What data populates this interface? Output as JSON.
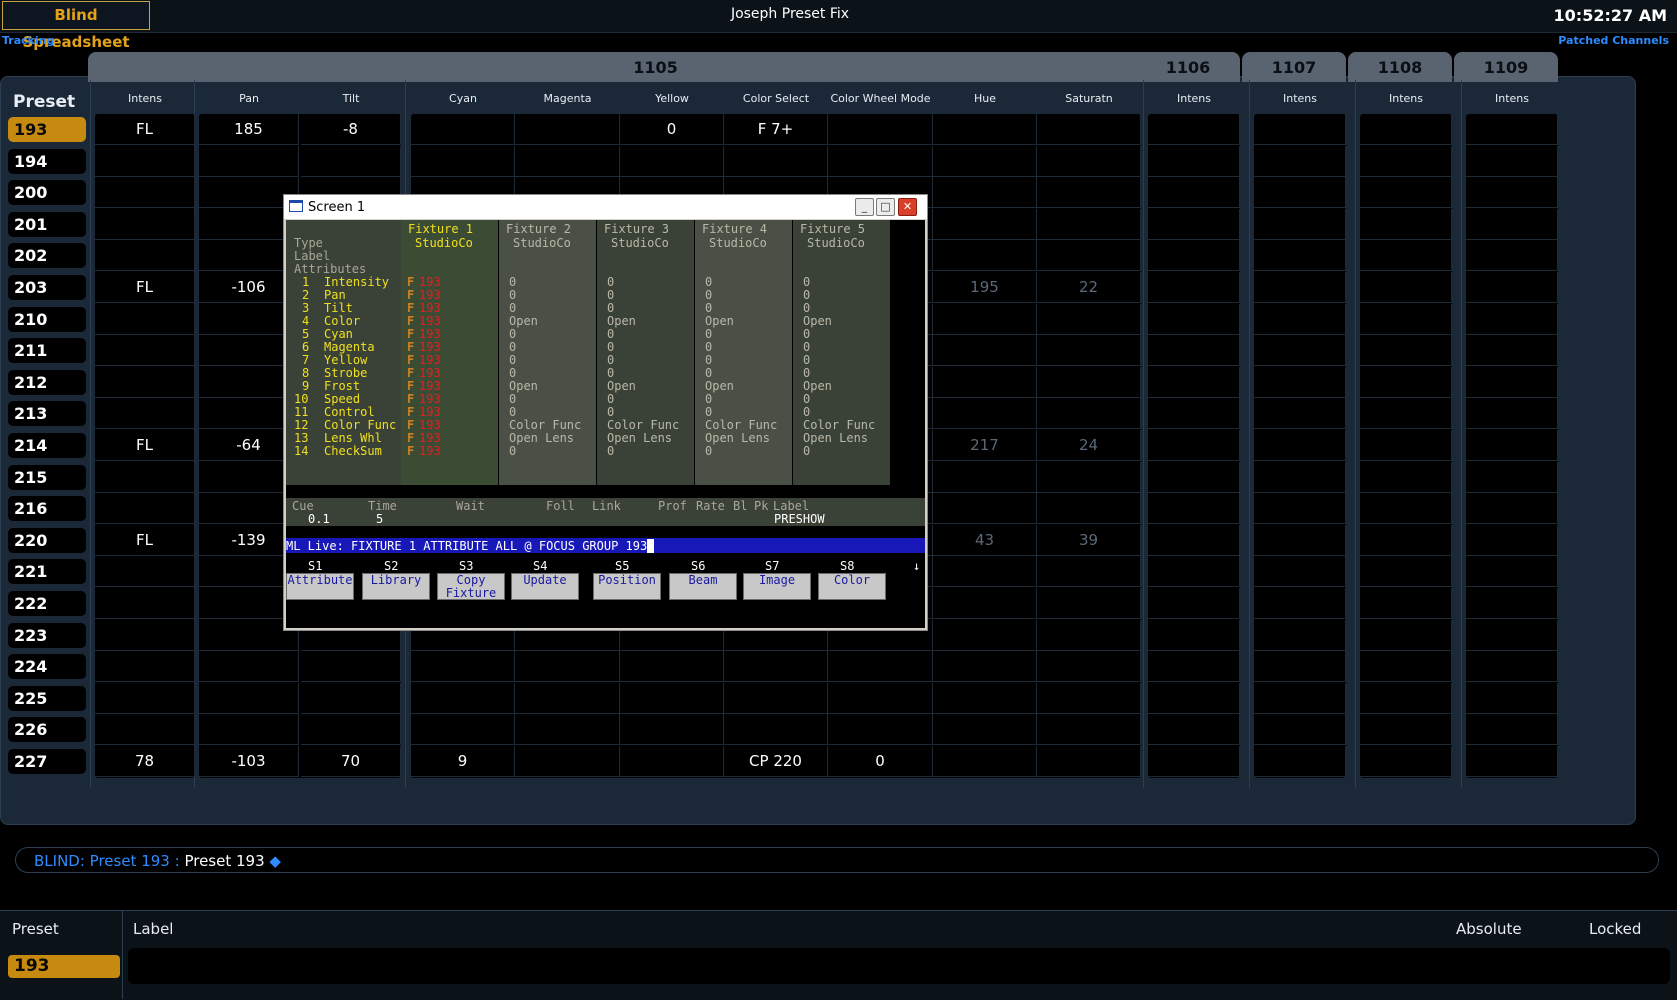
{
  "header": {
    "app_title": "Blind Spreadsheet",
    "show_name": "Joseph Preset Fix",
    "clock": "10:52:27 AM",
    "mode_left": "Tracking",
    "mode_right": "Patched Channels"
  },
  "sheet": {
    "preset_header": "Preset",
    "channel_groups": [
      "1105",
      "1106",
      "1107",
      "1108",
      "1109"
    ],
    "columns": [
      "Intens",
      "Pan",
      "Tilt",
      "Cyan",
      "Magenta",
      "Yellow",
      "Color Select",
      "Color Wheel Mode",
      "Hue",
      "Saturatn",
      "Intens",
      "Intens",
      "Intens",
      "Intens"
    ],
    "rows": [
      {
        "preset": "193",
        "cells": [
          "FL",
          "185",
          "-8",
          "",
          "",
          "0",
          "F 7+",
          "",
          "",
          "",
          "",
          "",
          "",
          ""
        ]
      },
      {
        "preset": "194",
        "cells": [
          "",
          "",
          "",
          "",
          "",
          "",
          "",
          "",
          "",
          "",
          "",
          "",
          "",
          ""
        ]
      },
      {
        "preset": "200",
        "cells": [
          "",
          "",
          "",
          "",
          "",
          "",
          "",
          "",
          "",
          "",
          "",
          "",
          "",
          ""
        ]
      },
      {
        "preset": "201",
        "cells": [
          "",
          "",
          "",
          "",
          "",
          "",
          "",
          "",
          "",
          "",
          "",
          "",
          "",
          ""
        ]
      },
      {
        "preset": "202",
        "cells": [
          "",
          "",
          "",
          "",
          "",
          "",
          "",
          "",
          "",
          "",
          "",
          "",
          "",
          ""
        ]
      },
      {
        "preset": "203",
        "cells": [
          "FL",
          "-106",
          "",
          "",
          "",
          "",
          "",
          "",
          "195",
          "22",
          "",
          "",
          "",
          ""
        ]
      },
      {
        "preset": "210",
        "cells": [
          "",
          "",
          "",
          "",
          "",
          "",
          "",
          "",
          "",
          "",
          "",
          "",
          "",
          ""
        ]
      },
      {
        "preset": "211",
        "cells": [
          "",
          "",
          "",
          "",
          "",
          "",
          "",
          "",
          "",
          "",
          "",
          "",
          "",
          ""
        ]
      },
      {
        "preset": "212",
        "cells": [
          "",
          "",
          "",
          "",
          "",
          "",
          "",
          "",
          "",
          "",
          "",
          "",
          "",
          ""
        ]
      },
      {
        "preset": "213",
        "cells": [
          "",
          "",
          "",
          "",
          "",
          "",
          "",
          "",
          "",
          "",
          "",
          "",
          "",
          ""
        ]
      },
      {
        "preset": "214",
        "cells": [
          "FL",
          "-64",
          "",
          "",
          "",
          "",
          "",
          "",
          "217",
          "24",
          "",
          "",
          "",
          ""
        ]
      },
      {
        "preset": "215",
        "cells": [
          "",
          "",
          "",
          "",
          "",
          "",
          "",
          "",
          "",
          "",
          "",
          "",
          "",
          ""
        ]
      },
      {
        "preset": "216",
        "cells": [
          "",
          "",
          "",
          "",
          "",
          "",
          "",
          "",
          "",
          "",
          "",
          "",
          "",
          ""
        ]
      },
      {
        "preset": "220",
        "cells": [
          "FL",
          "-139",
          "",
          "",
          "",
          "",
          "",
          "",
          "43",
          "39",
          "",
          "",
          "",
          ""
        ]
      },
      {
        "preset": "221",
        "cells": [
          "",
          "",
          "",
          "",
          "",
          "",
          "",
          "",
          "",
          "",
          "",
          "",
          "",
          ""
        ]
      },
      {
        "preset": "222",
        "cells": [
          "",
          "",
          "",
          "",
          "",
          "",
          "",
          "",
          "",
          "",
          "",
          "",
          "",
          ""
        ]
      },
      {
        "preset": "223",
        "cells": [
          "",
          "",
          "",
          "",
          "",
          "",
          "",
          "",
          "",
          "",
          "",
          "",
          "",
          ""
        ]
      },
      {
        "preset": "224",
        "cells": [
          "",
          "",
          "",
          "",
          "",
          "",
          "",
          "",
          "",
          "",
          "",
          "",
          "",
          ""
        ]
      },
      {
        "preset": "225",
        "cells": [
          "",
          "",
          "",
          "",
          "",
          "",
          "",
          "",
          "",
          "",
          "",
          "",
          "",
          ""
        ]
      },
      {
        "preset": "226",
        "cells": [
          "",
          "",
          "",
          "",
          "",
          "",
          "",
          "",
          "",
          "",
          "",
          "",
          "",
          ""
        ]
      },
      {
        "preset": "227",
        "cells": [
          "78",
          "-103",
          "70",
          "9",
          "",
          "",
          "CP 220",
          "0",
          "",
          "",
          "",
          "",
          "",
          ""
        ]
      }
    ]
  },
  "command_line": {
    "blind": "BLIND: Preset  193 :",
    "text": "Preset 193"
  },
  "bottom": {
    "preset_label": "Preset",
    "label_label": "Label",
    "absolute_label": "Absolute",
    "locked_label": "Locked",
    "preset_value": "193"
  },
  "screen1": {
    "title": "Screen 1",
    "row_labels": [
      "Type",
      "Label",
      "Attributes"
    ],
    "fixtures": [
      {
        "name": "Fixture 1",
        "type": "StudioCo"
      },
      {
        "name": "Fixture 2",
        "type": "StudioCo"
      },
      {
        "name": "Fixture 3",
        "type": "StudioCo"
      },
      {
        "name": "Fixture 4",
        "type": "StudioCo"
      },
      {
        "name": "Fixture 5",
        "type": "StudioCo"
      }
    ],
    "attributes": [
      {
        "num": "1",
        "name": "Intensity",
        "f1": "193",
        "other": "0"
      },
      {
        "num": "2",
        "name": "Pan",
        "f1": "193",
        "other": "0"
      },
      {
        "num": "3",
        "name": "Tilt",
        "f1": "193",
        "other": "0"
      },
      {
        "num": "4",
        "name": "Color",
        "f1": "193",
        "other": "Open"
      },
      {
        "num": "5",
        "name": "Cyan",
        "f1": "193",
        "other": "0"
      },
      {
        "num": "6",
        "name": "Magenta",
        "f1": "193",
        "other": "0"
      },
      {
        "num": "7",
        "name": "Yellow",
        "f1": "193",
        "other": "0"
      },
      {
        "num": "8",
        "name": "Strobe",
        "f1": "193",
        "other": "0"
      },
      {
        "num": "9",
        "name": "Frost",
        "f1": "193",
        "other": "Open"
      },
      {
        "num": "10",
        "name": "Speed",
        "f1": "193",
        "other": "0"
      },
      {
        "num": "11",
        "name": "Control",
        "f1": "193",
        "other": "0"
      },
      {
        "num": "12",
        "name": "Color Func",
        "f1": "193",
        "other": "Color Func"
      },
      {
        "num": "13",
        "name": "Lens Whl",
        "f1": "193",
        "other": "Open Lens"
      },
      {
        "num": "14",
        "name": "CheckSum",
        "f1": "193",
        "other": "0"
      }
    ],
    "cue_bar": {
      "headers": [
        "Cue",
        "Time",
        "Wait",
        "Foll",
        "Link",
        "Prof",
        "Rate",
        "Bl",
        "Pk",
        "Label"
      ],
      "cue": "0.1",
      "time": "5",
      "label": "PRESHOW"
    },
    "command": "ML Live: FIXTURE 1 ATTRIBUTE ALL @ FOCUS GROUP 193",
    "softkeys": [
      {
        "key": "S1",
        "label": "Attribute"
      },
      {
        "key": "S2",
        "label": "Library"
      },
      {
        "key": "S3",
        "label": "Copy\nFixture"
      },
      {
        "key": "S4",
        "label": "Update"
      },
      {
        "key": "S5",
        "label": "Position"
      },
      {
        "key": "S6",
        "label": "Beam"
      },
      {
        "key": "S7",
        "label": "Image"
      },
      {
        "key": "S8",
        "label": "Color"
      }
    ]
  }
}
